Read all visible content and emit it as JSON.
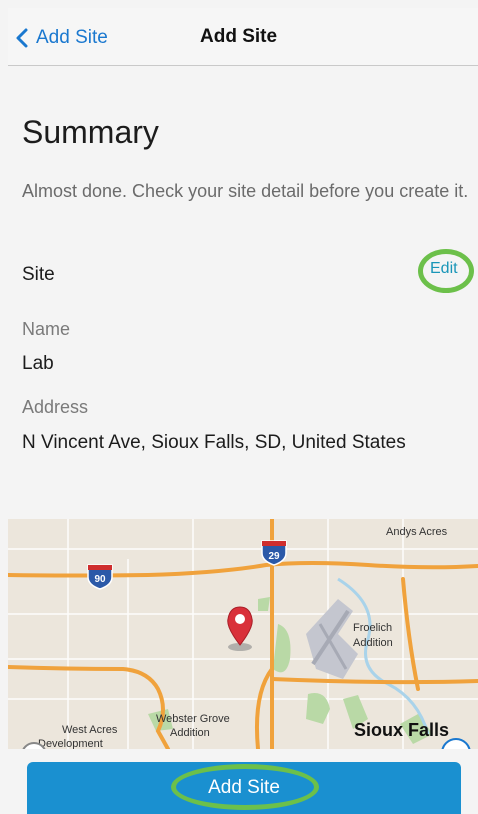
{
  "nav": {
    "back_label": "Add Site",
    "title": "Add Site"
  },
  "summary": {
    "title": "Summary",
    "description": "Almost done. Check your site detail before you create it.",
    "site_label": "Site",
    "edit_label": "Edit",
    "name_label": "Name",
    "name_value": "Lab",
    "address_label": "Address",
    "address_value": "N Vincent Ave, Sioux Falls, SD, United States"
  },
  "map": {
    "labels": {
      "andys_acres": "Andys Acres",
      "froelich": "Froelich",
      "addition1": "Addition",
      "west_acres": "West Acres",
      "development": "Development",
      "webster_grove": "Webster Grove",
      "addition2": "Addition",
      "sioux_falls": "Sioux Falls",
      "i29": "29",
      "i90": "90"
    },
    "colors": {
      "land": "#ece6dc",
      "highway": "#f0a23c",
      "shield": "#2b59a8",
      "pin": "#d9303a",
      "park": "#b9d9a6",
      "water": "#a9d3ea",
      "airport": "#c4c6cf"
    }
  },
  "actions": {
    "add_site_label": "Add Site"
  },
  "colors": {
    "accent": "#1a78cf",
    "button": "#1a90d0",
    "highlight": "#6cc04a"
  }
}
